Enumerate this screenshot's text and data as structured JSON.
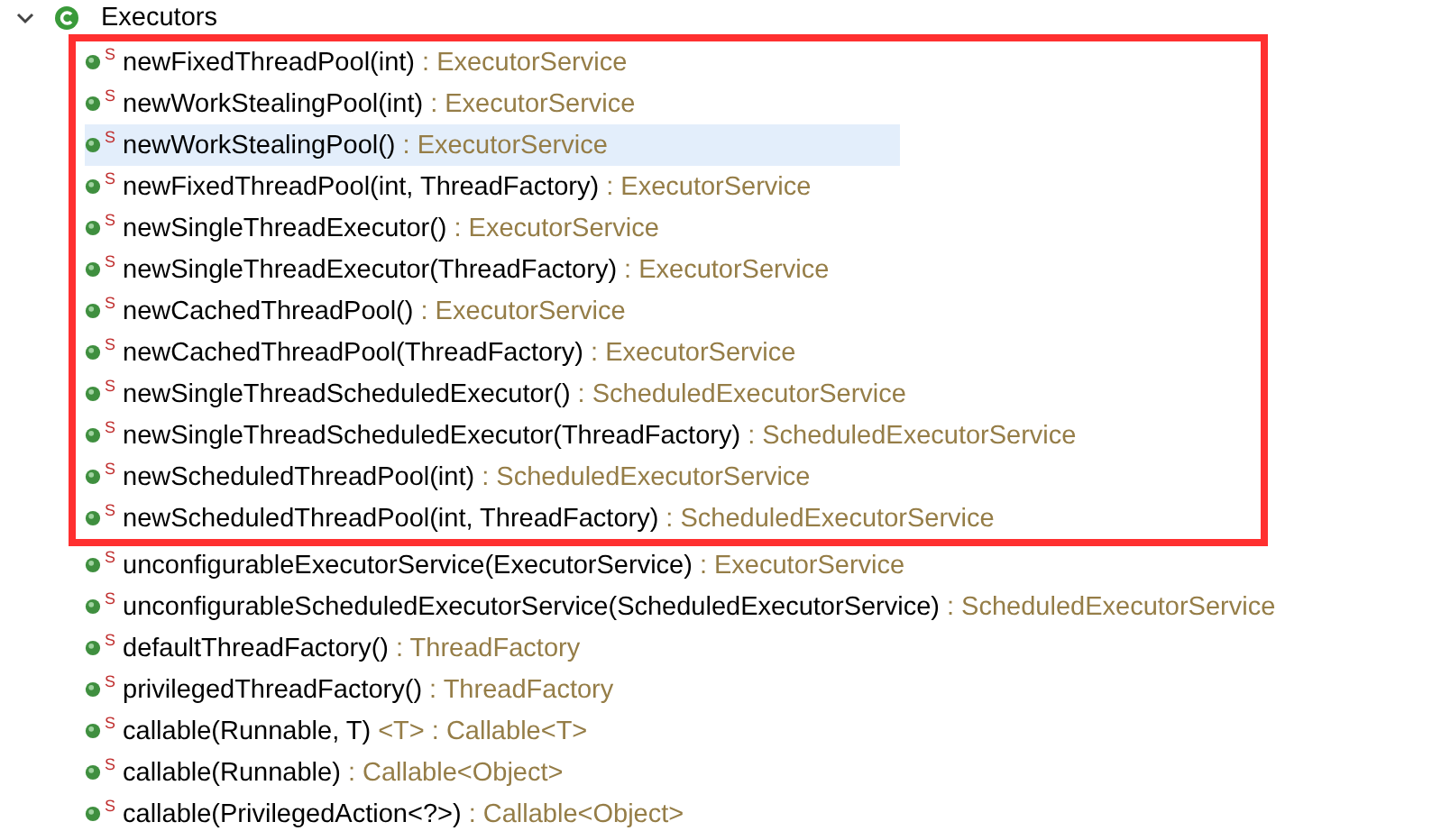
{
  "class_node": {
    "name": "Executors",
    "expanded": true
  },
  "highlighted_methods": [
    {
      "modifier": "S",
      "signature": "newFixedThreadPool(int)",
      "type": ": ExecutorService",
      "selected": false
    },
    {
      "modifier": "S",
      "signature": "newWorkStealingPool(int)",
      "type": ": ExecutorService",
      "selected": false
    },
    {
      "modifier": "S",
      "signature": "newWorkStealingPool()",
      "type": ": ExecutorService",
      "selected": true
    },
    {
      "modifier": "S",
      "signature": "newFixedThreadPool(int, ThreadFactory)",
      "type": ": ExecutorService",
      "selected": false
    },
    {
      "modifier": "S",
      "signature": "newSingleThreadExecutor()",
      "type": ": ExecutorService",
      "selected": false
    },
    {
      "modifier": "S",
      "signature": "newSingleThreadExecutor(ThreadFactory)",
      "type": ": ExecutorService",
      "selected": false
    },
    {
      "modifier": "S",
      "signature": "newCachedThreadPool()",
      "type": ": ExecutorService",
      "selected": false
    },
    {
      "modifier": "S",
      "signature": "newCachedThreadPool(ThreadFactory)",
      "type": ": ExecutorService",
      "selected": false
    },
    {
      "modifier": "S",
      "signature": "newSingleThreadScheduledExecutor()",
      "type": ": ScheduledExecutorService",
      "selected": false
    },
    {
      "modifier": "S",
      "signature": "newSingleThreadScheduledExecutor(ThreadFactory)",
      "type": ": ScheduledExecutorService",
      "selected": false
    },
    {
      "modifier": "S",
      "signature": "newScheduledThreadPool(int)",
      "type": ": ScheduledExecutorService",
      "selected": false
    },
    {
      "modifier": "S",
      "signature": "newScheduledThreadPool(int, ThreadFactory)",
      "type": ": ScheduledExecutorService",
      "selected": false
    }
  ],
  "other_methods": [
    {
      "modifier": "S",
      "signature": "unconfigurableExecutorService(ExecutorService)",
      "type": ": ExecutorService",
      "selected": false
    },
    {
      "modifier": "S",
      "signature": "unconfigurableScheduledExecutorService(ScheduledExecutorService)",
      "type": ": ScheduledExecutorService",
      "selected": false
    },
    {
      "modifier": "S",
      "signature": "defaultThreadFactory()",
      "type": ": ThreadFactory",
      "selected": false
    },
    {
      "modifier": "S",
      "signature": "privilegedThreadFactory()",
      "type": ": ThreadFactory",
      "selected": false
    },
    {
      "modifier": "S",
      "signature": "callable(Runnable, T)",
      "type": "<T> : Callable<T>",
      "selected": false
    },
    {
      "modifier": "S",
      "signature": "callable(Runnable)",
      "type": ": Callable<Object>",
      "selected": false
    },
    {
      "modifier": "S",
      "signature": "callable(PrivilegedAction<?>)",
      "type": ": Callable<Object>",
      "selected": false
    }
  ]
}
